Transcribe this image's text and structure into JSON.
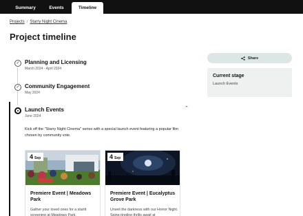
{
  "tabs": [
    {
      "label": "Summary"
    },
    {
      "label": "Events"
    },
    {
      "label": "Timeline"
    }
  ],
  "breadcrumb": {
    "items": [
      "Projects",
      "Starry Night Cinema"
    ],
    "separator": "/"
  },
  "page_title": "Project timeline",
  "timeline": {
    "stages": [
      {
        "title": "Planning and Licensing",
        "date": "March 2024 - April 2024",
        "status": "done"
      },
      {
        "title": "Community Engagement",
        "date": "May 2024",
        "status": "done"
      },
      {
        "title": "Launch Events",
        "date": "June 2024",
        "status": "current"
      }
    ],
    "active_description": "Kick off the \"Starry Night Cinema\" series with a special launch event featuring a popular film chosen by community vote.",
    "events": [
      {
        "day": "4",
        "month": "Sep",
        "title": "Premiere Event | Meadows Park",
        "body": "Gather your loved ones for a starlit screening at Meadows Park."
      },
      {
        "day": "4",
        "month": "Sep",
        "title": "Premiere Event | Eucalyptus Grove Park",
        "body": "Unveil the darkness with our Horror Night. Spine-tingling thrills await at"
      }
    ]
  },
  "sidebar": {
    "share_label": "Share",
    "current_stage": {
      "title": "Current stage",
      "value": "Launch Events"
    }
  },
  "colors": {
    "topbar": "#111111",
    "share_bg": "#dde6e6",
    "stage_box_bg": "#eef1f0"
  }
}
